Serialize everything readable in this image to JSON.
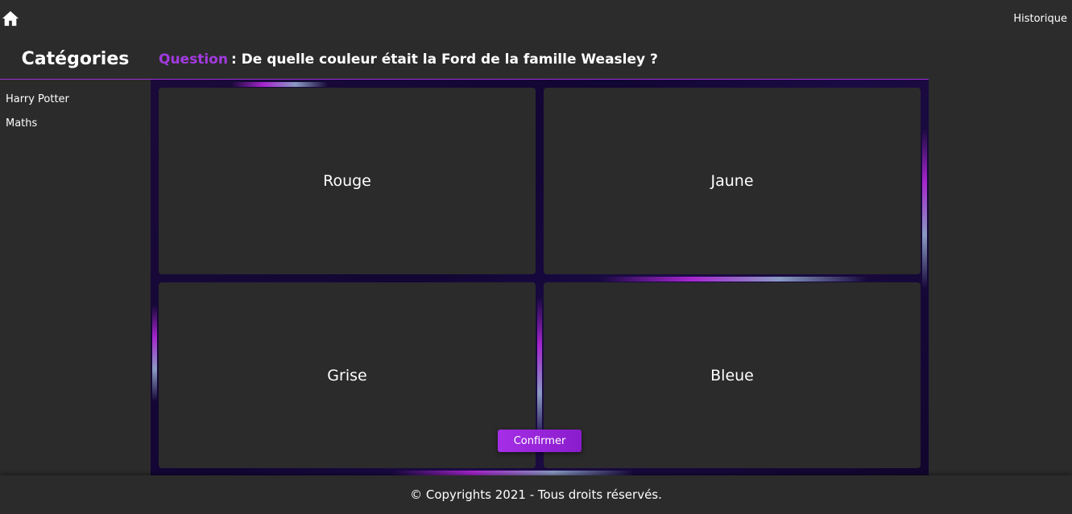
{
  "header": {
    "home_icon": "home-icon",
    "history_label": "Historique"
  },
  "sidebar": {
    "title": "Catégories",
    "items": [
      {
        "label": "Harry Potter"
      },
      {
        "label": "Maths"
      }
    ]
  },
  "quiz": {
    "question_label": "Question",
    "question_text": ": De quelle couleur était la Ford de la famille Weasley ?",
    "answers": [
      {
        "label": "Rouge"
      },
      {
        "label": "Jaune"
      },
      {
        "label": "Grise"
      },
      {
        "label": "Bleue"
      }
    ],
    "confirm_label": "Confirmer"
  },
  "footer": {
    "text": "© Copyrights 2021 - Tous droits réservés."
  },
  "colors": {
    "accent": "#a33ae0",
    "background": "#2b2b2b",
    "quiz_background": "#10062a"
  }
}
